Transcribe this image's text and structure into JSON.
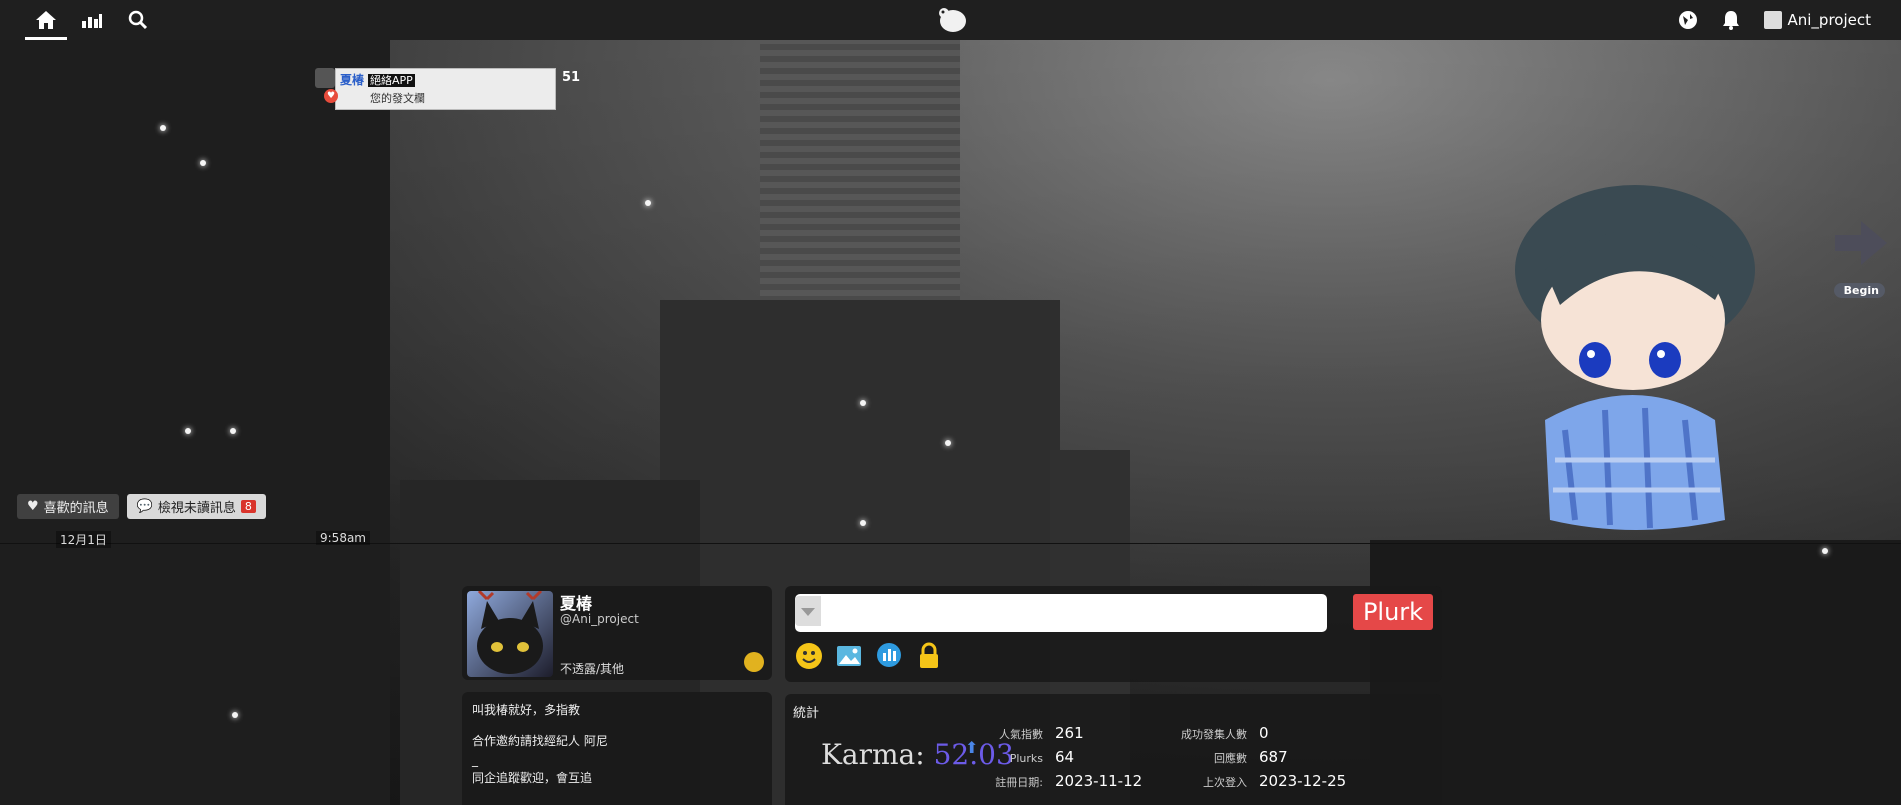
{
  "topbar": {
    "user_name": "Ani_project"
  },
  "timeline": {
    "plurk": {
      "author": "夏椿",
      "qualifier": "絕絡APP",
      "text": "您的發文欄",
      "response_count": "51"
    },
    "filters": {
      "liked": "喜歡的訊息",
      "unread": "檢視未讀訊息",
      "unread_count": "8"
    },
    "date_label": "12月1日",
    "time_label": "9:58am",
    "begin_label": "Begin"
  },
  "profile": {
    "display_name": "夏椿",
    "handle": "@Ani_project",
    "relationship": "不透露/其他"
  },
  "about": {
    "lines": [
      "叫我椿就好，多指教",
      "合作邀約請找經紀人 阿尼",
      "_",
      "同企追蹤歡迎，會互追"
    ]
  },
  "plurk_form": {
    "submit_label": "Plurk"
  },
  "stats": {
    "title": "統計",
    "karma_label": "Karma:",
    "karma_value": "52.03",
    "popularity_label": "人氣指數",
    "popularity_value": "261",
    "plurks_label": "Plurks",
    "plurks_value": "64",
    "join_label": "註冊日期:",
    "join_value": "2023-11-12",
    "invites_label": "成功發集人數",
    "invites_value": "0",
    "responses_label": "回應數",
    "responses_value": "687",
    "last_login_label": "上次登入",
    "last_login_value": "2023-12-25"
  },
  "colors": {
    "topbar": "#1f1f1f",
    "plurk_button": "#e54848",
    "karma_value": "#6c5be8",
    "unread_badge": "#d9342b"
  }
}
